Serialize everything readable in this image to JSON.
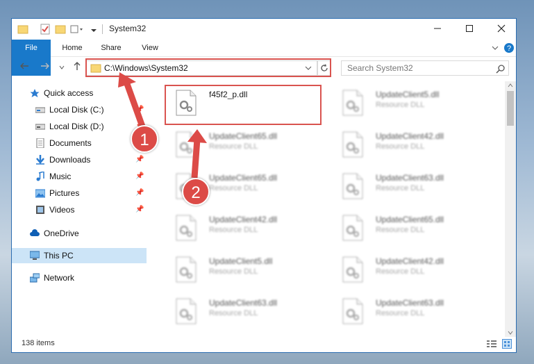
{
  "window": {
    "title": "System32",
    "controls": [
      "minimize-icon",
      "maximize-icon",
      "close-icon"
    ]
  },
  "ribbon": {
    "tabs": [
      {
        "label": "File"
      },
      {
        "label": "Home"
      },
      {
        "label": "Share"
      },
      {
        "label": "View"
      }
    ]
  },
  "address": {
    "path": "C:\\Windows\\System32",
    "search_placeholder": "Search System32"
  },
  "nav": {
    "items": [
      {
        "label": "Quick access",
        "icon": "star-icon"
      },
      {
        "label": "Local Disk (C:)",
        "icon": "drive-icon"
      },
      {
        "label": "Local Disk (D:)",
        "icon": "drive-icon"
      },
      {
        "label": "Documents",
        "icon": "documents-icon"
      },
      {
        "label": "Downloads",
        "icon": "download-icon"
      },
      {
        "label": "Music",
        "icon": "music-icon"
      },
      {
        "label": "Pictures",
        "icon": "pictures-icon"
      },
      {
        "label": "Videos",
        "icon": "videos-icon"
      },
      {
        "label": "OneDrive",
        "icon": "cloud-icon"
      },
      {
        "label": "This PC",
        "icon": "pc-icon"
      },
      {
        "label": "Network",
        "icon": "network-icon"
      }
    ]
  },
  "files": [
    {
      "name": "f45f2_p.dll",
      "type": ""
    },
    {
      "name": "UpdateClient5.dll",
      "type": "Resource DLL"
    },
    {
      "name": "UpdateClient65.dll",
      "type": "Resource DLL"
    },
    {
      "name": "UpdateClient42.dll",
      "type": "Resource DLL"
    },
    {
      "name": "UpdateClient65.dll",
      "type": "Resource DLL"
    },
    {
      "name": "UpdateClient63.dll",
      "type": "Resource DLL"
    },
    {
      "name": "UpdateClient42.dll",
      "type": "Resource DLL"
    },
    {
      "name": "UpdateClient65.dll",
      "type": "Resource DLL"
    },
    {
      "name": "UpdateClient5.dll",
      "type": "Resource DLL"
    },
    {
      "name": "UpdateClient42.dll",
      "type": "Resource DLL"
    },
    {
      "name": "UpdateClient63.dll",
      "type": "Resource DLL"
    },
    {
      "name": "UpdateClient63.dll",
      "type": "Resource DLL"
    }
  ],
  "status": {
    "item_count": "138 items"
  },
  "annotations": {
    "step1": "1",
    "step2": "2",
    "color": "#dc4b47"
  }
}
